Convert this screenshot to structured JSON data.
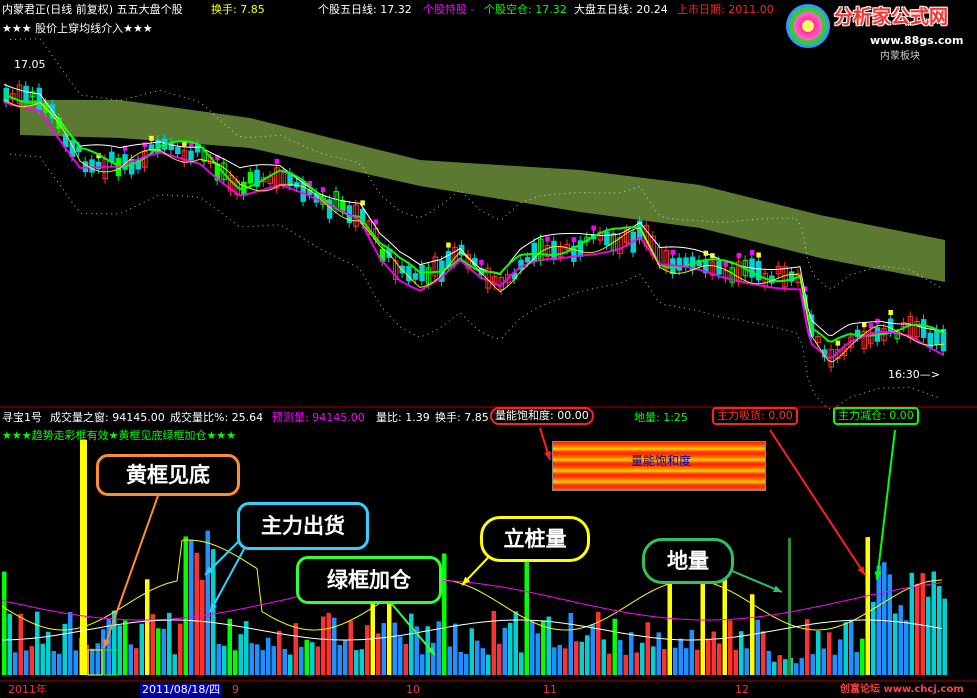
{
  "header": {
    "title": "内蒙君正(日线 前复权) 五五大盘个股",
    "turnover": "换手: 7.85",
    "stock_ma5": "个股五日线: 17.32",
    "stock_hold": "个股持股 -",
    "stock_empty": "个股空仓: 17.32",
    "index_ma5": "大盘五日线: 20.24",
    "listing_date": "上市日期: 2011.00"
  },
  "signal_line": "★★★ 股价上穿均线介入★★★",
  "price_label_top": "17.05",
  "time_label": "16:30—>",
  "logo": {
    "main": "分析家公式网",
    "url": "www.88gs.com",
    "sub": "内蒙板块"
  },
  "lower_header": {
    "name": "寻宝1号",
    "vol_window": "成交量之窗: 94145.00",
    "vol_ratio": "成交量比%: 25.64",
    "forecast": "预测量: 94145.00",
    "ratio": "量比: 1.39",
    "turnover": "换手: 7.85",
    "saturation": "量能饱和度: 00.00",
    "ground_volume": "地量: 1:25",
    "main_absorb": "主力吸货: 0.00",
    "main_reduce": "主力减仓: 0.00"
  },
  "lower_signal": "★★★趋势走彩框有效★黄框见底绿框加仓★★★",
  "saturation_box_label": "量能饱和度",
  "callouts": {
    "yellow_bottom": "黄框见底",
    "main_sell": "主力出货",
    "green_add": "绿框加仓",
    "pile_volume": "立桩量",
    "ground": "地量"
  },
  "time_axis": {
    "year": "2011年",
    "date": "2011/08/18/四",
    "m9": "9",
    "m10": "10",
    "m11": "11",
    "m12": "12"
  },
  "footer_brand": "创富论坛 www.chcj.com",
  "colors": {
    "up": "#ff3030",
    "down": "#00d0d0",
    "vol_down": "#1e90ff",
    "yellow": "#ffff00",
    "green": "#00ff00",
    "magenta": "#ff00ff",
    "band": "#6b8e3a"
  }
}
